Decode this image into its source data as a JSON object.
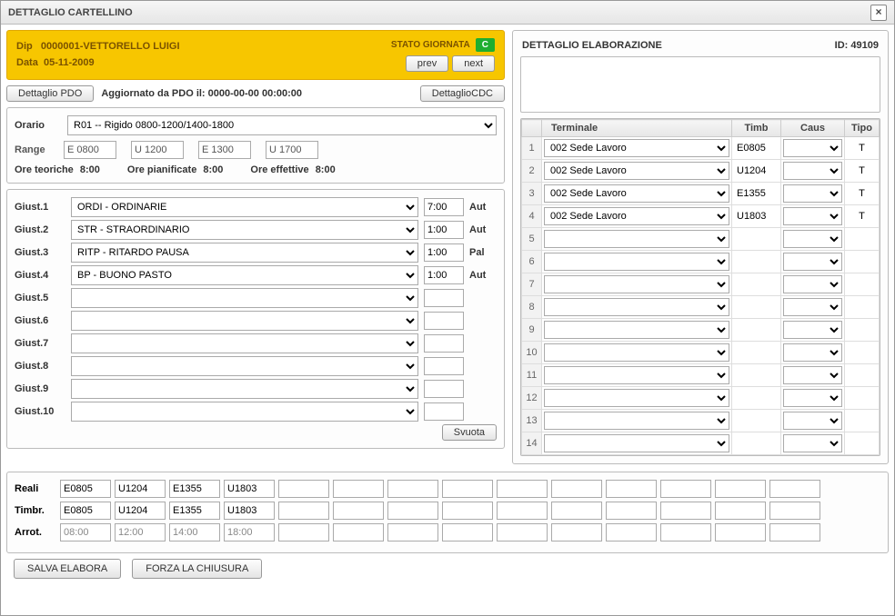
{
  "window": {
    "title": "DETTAGLIO CARTELLINO"
  },
  "header": {
    "dip_label": "Dip",
    "dip_value": "0000001-VETTORELLO LUIGI",
    "data_label": "Data",
    "data_value": "05-11-2009",
    "stato_label": "STATO GIORNATA",
    "stato_value": "C",
    "prev": "prev",
    "next": "next"
  },
  "pdo": {
    "btn": "Dettaglio PDO",
    "text": "Aggiornato da PDO il: 0000-00-00 00:00:00",
    "cdc": "DettaglioCDC"
  },
  "orario": {
    "label": "Orario",
    "value": "R01 -- Rigido 0800-1200/1400-1800",
    "range_label": "Range",
    "range": [
      "E 0800",
      "U 1200",
      "E 1300",
      "U 1700"
    ],
    "ore_teoriche_label": "Ore teoriche",
    "ore_teoriche": "8:00",
    "ore_pianificate_label": "Ore pianificate",
    "ore_pianificate": "8:00",
    "ore_effettive_label": "Ore effettive",
    "ore_effettive": "8:00"
  },
  "giust": {
    "svuota": "Svuota",
    "rows": [
      {
        "label": "Giust.1",
        "combo": "ORDI - ORDINARIE",
        "hours": "7:00",
        "aut": "Aut"
      },
      {
        "label": "Giust.2",
        "combo": "STR - STRAORDINARIO",
        "hours": "1:00",
        "aut": "Aut"
      },
      {
        "label": "Giust.3",
        "combo": "RITP - RITARDO PAUSA",
        "hours": "1:00",
        "aut": "Pal"
      },
      {
        "label": "Giust.4",
        "combo": "BP - BUONO PASTO",
        "hours": "1:00",
        "aut": "Aut"
      },
      {
        "label": "Giust.5",
        "combo": "",
        "hours": "",
        "aut": ""
      },
      {
        "label": "Giust.6",
        "combo": "",
        "hours": "",
        "aut": ""
      },
      {
        "label": "Giust.7",
        "combo": "",
        "hours": "",
        "aut": ""
      },
      {
        "label": "Giust.8",
        "combo": "",
        "hours": "",
        "aut": ""
      },
      {
        "label": "Giust.9",
        "combo": "",
        "hours": "",
        "aut": ""
      },
      {
        "label": "Giust.10",
        "combo": "",
        "hours": "",
        "aut": ""
      }
    ]
  },
  "elab": {
    "title": "DETTAGLIO ELABORAZIONE",
    "id_label": "ID:",
    "id": "49109"
  },
  "term": {
    "headers": {
      "terminale": "Terminale",
      "timb": "Timb",
      "caus": "Caus",
      "tipo": "Tipo"
    },
    "rows": [
      {
        "n": "1",
        "terminale": "002 Sede Lavoro",
        "timb": "E0805",
        "caus": "",
        "tipo": "T"
      },
      {
        "n": "2",
        "terminale": "002 Sede Lavoro",
        "timb": "U1204",
        "caus": "",
        "tipo": "T"
      },
      {
        "n": "3",
        "terminale": "002 Sede Lavoro",
        "timb": "E1355",
        "caus": "",
        "tipo": "T"
      },
      {
        "n": "4",
        "terminale": "002 Sede Lavoro",
        "timb": "U1803",
        "caus": "",
        "tipo": "T"
      },
      {
        "n": "5",
        "terminale": "",
        "timb": "",
        "caus": "",
        "tipo": ""
      },
      {
        "n": "6",
        "terminale": "",
        "timb": "",
        "caus": "",
        "tipo": ""
      },
      {
        "n": "7",
        "terminale": "",
        "timb": "",
        "caus": "",
        "tipo": ""
      },
      {
        "n": "8",
        "terminale": "",
        "timb": "",
        "caus": "",
        "tipo": ""
      },
      {
        "n": "9",
        "terminale": "",
        "timb": "",
        "caus": "",
        "tipo": ""
      },
      {
        "n": "10",
        "terminale": "",
        "timb": "",
        "caus": "",
        "tipo": ""
      },
      {
        "n": "11",
        "terminale": "",
        "timb": "",
        "caus": "",
        "tipo": ""
      },
      {
        "n": "12",
        "terminale": "",
        "timb": "",
        "caus": "",
        "tipo": ""
      },
      {
        "n": "13",
        "terminale": "",
        "timb": "",
        "caus": "",
        "tipo": ""
      },
      {
        "n": "14",
        "terminale": "",
        "timb": "",
        "caus": "",
        "tipo": ""
      }
    ]
  },
  "bottom": {
    "reali_label": "Reali",
    "timbr_label": "Timbr.",
    "arrot_label": "Arrot.",
    "reali": [
      "E0805",
      "U1204",
      "E1355",
      "U1803",
      "",
      "",
      "",
      "",
      "",
      "",
      "",
      "",
      "",
      ""
    ],
    "timbr": [
      "E0805",
      "U1204",
      "E1355",
      "U1803",
      "",
      "",
      "",
      "",
      "",
      "",
      "",
      "",
      "",
      ""
    ],
    "arrot": [
      "08:00",
      "12:00",
      "14:00",
      "18:00",
      "",
      "",
      "",
      "",
      "",
      "",
      "",
      "",
      "",
      ""
    ]
  },
  "footer": {
    "salva": "SALVA ELABORA",
    "forza": "FORZA LA CHIUSURA"
  }
}
